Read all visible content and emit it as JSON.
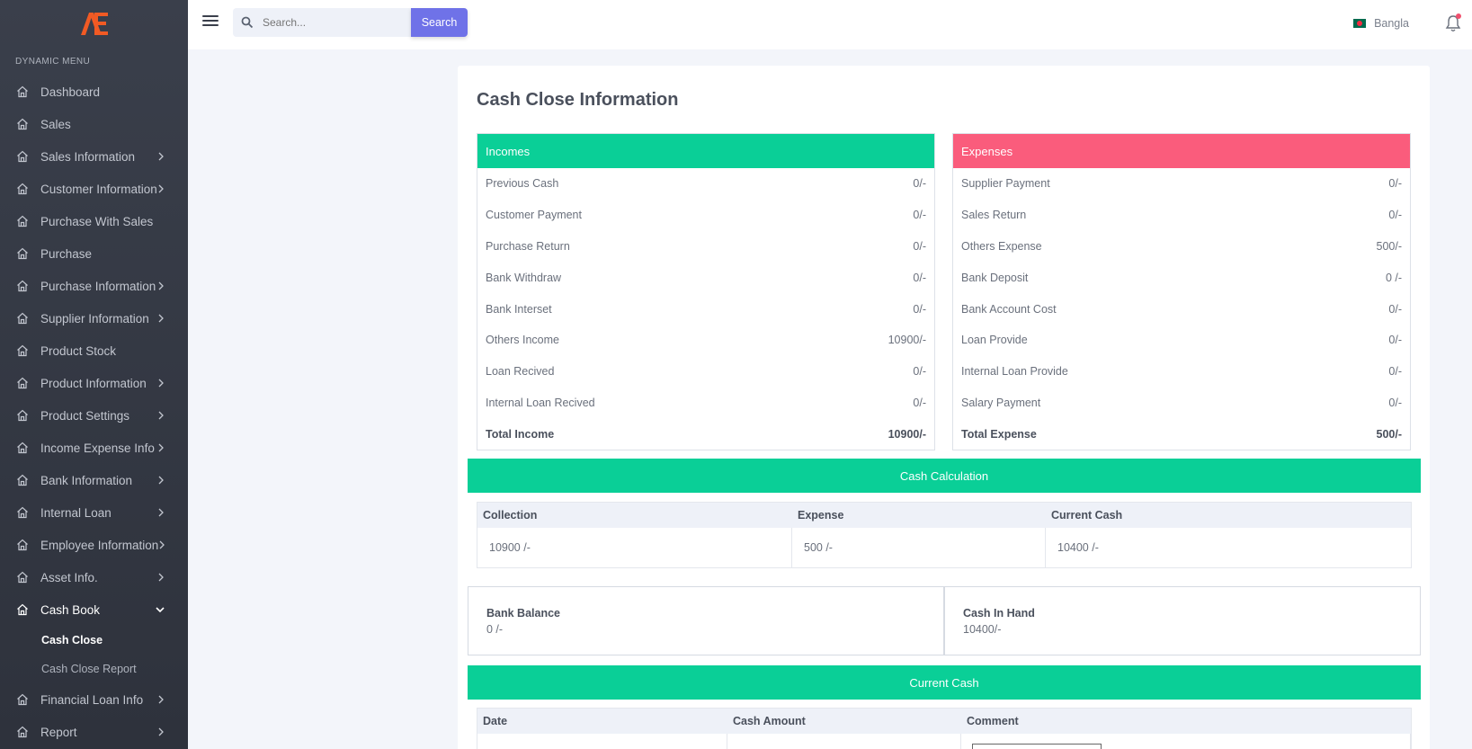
{
  "sidebar": {
    "menu_title": "DYNAMIC MENU",
    "items": [
      {
        "label": "Dashboard",
        "has_arrow": false
      },
      {
        "label": "Sales",
        "has_arrow": false
      },
      {
        "label": "Sales Information",
        "has_arrow": true
      },
      {
        "label": "Customer Information",
        "has_arrow": true
      },
      {
        "label": "Purchase With Sales",
        "has_arrow": false
      },
      {
        "label": "Purchase",
        "has_arrow": false
      },
      {
        "label": "Purchase Information",
        "has_arrow": true
      },
      {
        "label": "Supplier Information",
        "has_arrow": true
      },
      {
        "label": "Product Stock",
        "has_arrow": false
      },
      {
        "label": "Product Information",
        "has_arrow": true
      },
      {
        "label": "Product Settings",
        "has_arrow": true
      },
      {
        "label": "Income Expense Info",
        "has_arrow": true
      },
      {
        "label": "Bank Information",
        "has_arrow": true
      },
      {
        "label": "Internal Loan",
        "has_arrow": true
      },
      {
        "label": "Employee Information",
        "has_arrow": true
      },
      {
        "label": "Asset Info.",
        "has_arrow": true
      },
      {
        "label": "Cash Book",
        "has_arrow": true,
        "expanded": true,
        "active": true
      },
      {
        "label": "Financial Loan Info",
        "has_arrow": true
      },
      {
        "label": "Report",
        "has_arrow": true
      }
    ],
    "cash_book_sub": [
      {
        "label": "Cash Close",
        "active": true
      },
      {
        "label": "Cash Close Report",
        "active": false
      }
    ]
  },
  "topbar": {
    "search_placeholder": "Search...",
    "search_button": "Search",
    "language": "Bangla"
  },
  "page": {
    "title": "Cash Close Information",
    "incomes": {
      "title": "Incomes",
      "rows": [
        {
          "label": "Previous Cash",
          "value": "0/-"
        },
        {
          "label": "Customer Payment",
          "value": "0/-"
        },
        {
          "label": "Purchase Return",
          "value": "0/-"
        },
        {
          "label": "Bank Withdraw",
          "value": "0/-"
        },
        {
          "label": "Bank Interset",
          "value": "0/-"
        },
        {
          "label": "Others Income",
          "value": "10900/-"
        },
        {
          "label": "Loan Recived",
          "value": "0/-"
        },
        {
          "label": "Internal Loan Recived",
          "value": "0/-"
        }
      ],
      "total_label": "Total Income",
      "total_value": "10900/-"
    },
    "expenses": {
      "title": "Expenses",
      "rows": [
        {
          "label": "Supplier Payment",
          "value": "0/-"
        },
        {
          "label": "Sales Return",
          "value": "0/-"
        },
        {
          "label": "Others Expense",
          "value": "500/-"
        },
        {
          "label": "Bank Deposit",
          "value": "0 /-"
        },
        {
          "label": "Bank Account Cost",
          "value": "0/-"
        },
        {
          "label": "Loan Provide",
          "value": "0/-"
        },
        {
          "label": "Internal Loan Provide",
          "value": "0/-"
        },
        {
          "label": "Salary Payment",
          "value": "0/-"
        }
      ],
      "total_label": "Total Expense",
      "total_value": "500/-"
    },
    "cash_calculation": {
      "title": "Cash Calculation",
      "headers": [
        "Collection",
        "Expense",
        "Current Cash"
      ],
      "values": [
        "10900 /-",
        "500 /-",
        "10400 /-"
      ]
    },
    "bank_balance": {
      "label": "Bank Balance",
      "value": "0 /-"
    },
    "cash_in_hand": {
      "label": "Cash In Hand",
      "value": "10400/-"
    },
    "current_cash": {
      "title": "Current Cash",
      "headers": [
        "Date",
        "Cash Amount",
        "Comment"
      ]
    }
  },
  "colors": {
    "sidebar_bg": "#353a45",
    "income_green": "#0acf97",
    "expense_red": "#fa5c7c",
    "search_button": "#6f72e8"
  }
}
